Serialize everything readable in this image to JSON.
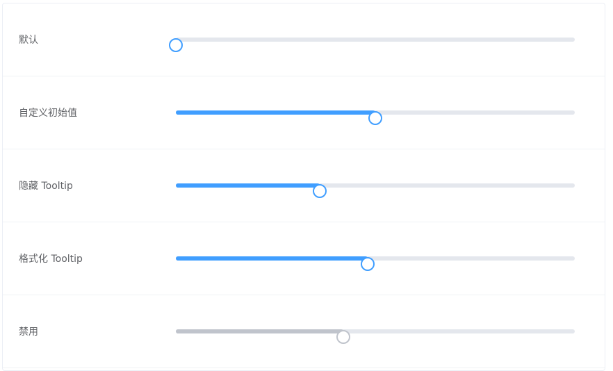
{
  "sliders": [
    {
      "label": "默认",
      "value": 0,
      "disabled": false
    },
    {
      "label": "自定义初始值",
      "value": 50,
      "disabled": false
    },
    {
      "label": "隐藏 Tooltip",
      "value": 36,
      "disabled": false
    },
    {
      "label": "格式化 Tooltip",
      "value": 48,
      "disabled": false
    },
    {
      "label": "禁用",
      "value": 42,
      "disabled": true
    }
  ],
  "colors": {
    "active": "#409eff",
    "disabled": "#c0c4cc",
    "runway": "#e4e7ed",
    "label": "#606266"
  }
}
